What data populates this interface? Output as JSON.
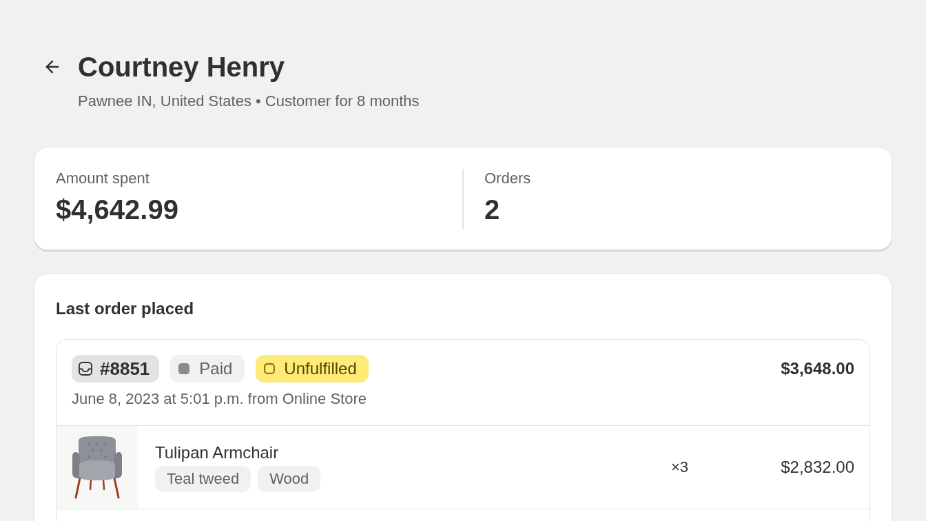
{
  "header": {
    "title": "Courtney Henry",
    "subtitle": "Pawnee IN, United States • Customer for 8 months"
  },
  "stats": [
    {
      "label": "Amount spent",
      "value": "$4,642.99"
    },
    {
      "label": "Orders",
      "value": "2"
    }
  ],
  "last_order": {
    "heading": "Last order placed",
    "badges": [
      {
        "kind": "order",
        "label": "#8851"
      },
      {
        "kind": "paid",
        "label": "Paid"
      },
      {
        "kind": "unfulfilled",
        "label": "Unfulfilled"
      }
    ],
    "total": "$3,648.00",
    "placed": "June 8, 2023 at 5:01 p.m. from Online Store",
    "items": [
      {
        "name": "Tulipan Armchair",
        "options": [
          "Teal tweed",
          "Wood"
        ],
        "quantity": "×3",
        "price": "$2,832.00"
      }
    ]
  }
}
